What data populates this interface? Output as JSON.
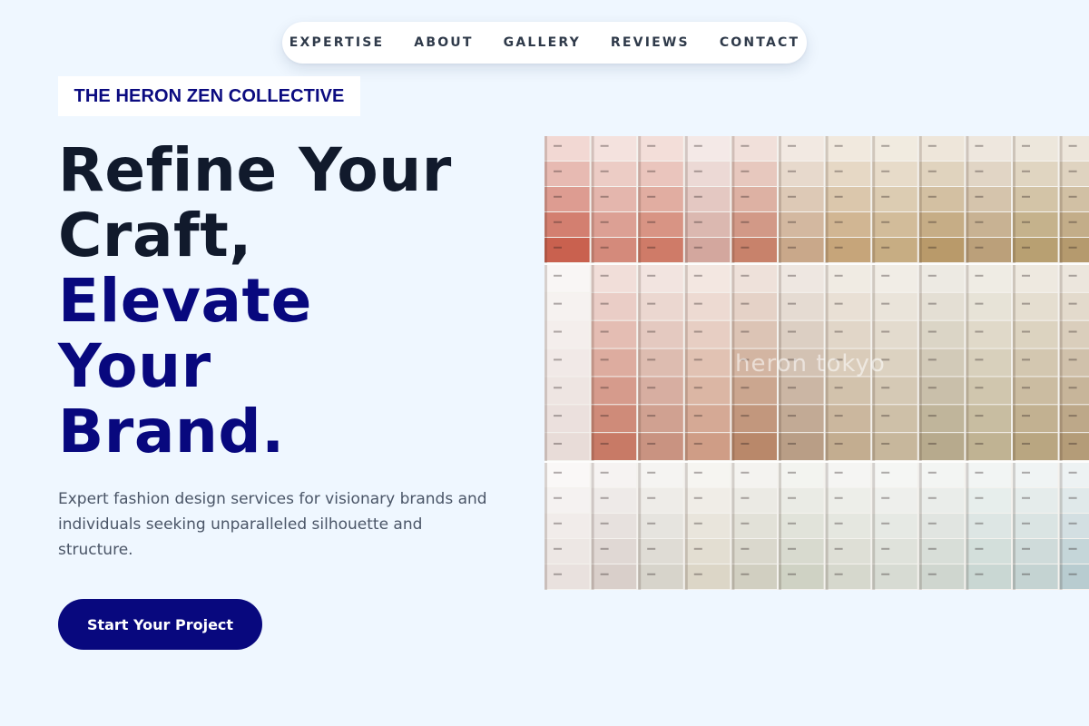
{
  "nav": {
    "items": [
      {
        "label": "EXPERTISE"
      },
      {
        "label": "ABOUT"
      },
      {
        "label": "GALLERY"
      },
      {
        "label": "REVIEWS"
      },
      {
        "label": "CONTACT"
      }
    ]
  },
  "brand": {
    "name": "THE HERON ZEN COLLECTIVE"
  },
  "hero": {
    "headline_line1": "Refine Your",
    "headline_line2": "Craft,",
    "headline_line3": "Elevate",
    "headline_line4": "Your",
    "headline_line5": "Brand.",
    "description": "Expert fashion design services for visionary brands and individuals seeking unparalleled silhouette and structure.",
    "cta_label": "Start Your Project",
    "image_watermark": "heron tokyo"
  },
  "colors": {
    "background": "#eff7ff",
    "accent": "#08087e",
    "heading_dark": "#111a2c",
    "body_text": "#4a5567"
  }
}
